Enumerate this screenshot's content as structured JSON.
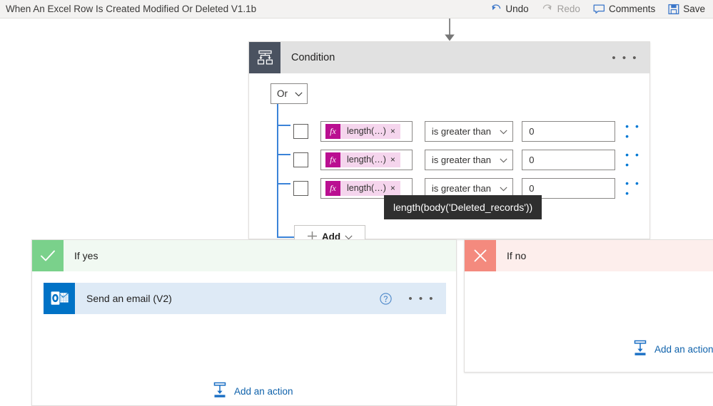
{
  "command_bar": {
    "flow_title": "When An Excel Row Is Created Modified Or Deleted V1.1b",
    "actions": [
      {
        "label": "Undo",
        "icon": "undo-icon",
        "enabled": true
      },
      {
        "label": "Redo",
        "icon": "redo-icon",
        "enabled": false
      },
      {
        "label": "Comments",
        "icon": "comment-icon",
        "enabled": true
      },
      {
        "label": "Save",
        "icon": "save-icon",
        "enabled": true
      }
    ]
  },
  "condition_card": {
    "title": "Condition",
    "icon": "condition-branch-icon",
    "overflow_label": "• • •",
    "logic_operator": {
      "value": "Or",
      "chevron": "chevron-down-icon"
    },
    "rows": [
      {
        "checkbox_checked": false,
        "token": {
          "fx_label": "fx",
          "text": "length(…)",
          "remove": "×"
        },
        "operator": "is greater than",
        "value": "0",
        "overflow_label": "• • •"
      },
      {
        "checkbox_checked": false,
        "token": {
          "fx_label": "fx",
          "text": "length(…)",
          "remove": "×"
        },
        "operator": "is greater than",
        "value": "0",
        "overflow_label": "• • •"
      },
      {
        "checkbox_checked": false,
        "token": {
          "fx_label": "fx",
          "text": "length(…)",
          "remove": "×"
        },
        "operator": "is greater than",
        "value": "0",
        "overflow_label": "• • •"
      }
    ],
    "add_button": {
      "label": "Add",
      "plus": "+",
      "chevron": "chevron-down-icon"
    },
    "expression_tooltip": "length(body('Deleted_records'))"
  },
  "branches": {
    "if_yes": {
      "label": "If yes",
      "icon": "checkmark-icon",
      "header_color": "#f1f9f2",
      "icon_color": "#7ad18b",
      "action": {
        "title": "Send an email (V2)",
        "icon": "outlook-icon",
        "help_icon": "help-circle-icon",
        "overflow_label": "• • •"
      },
      "add_action": {
        "label": "Add an action",
        "icon": "add-action-icon"
      }
    },
    "if_no": {
      "label": "If no",
      "icon": "cross-icon",
      "header_color": "#fdeeec",
      "icon_color": "#f48a7e",
      "add_action": {
        "label": "Add an action",
        "icon": "add-action-icon"
      }
    }
  },
  "colors": {
    "accent_blue": "#0078d4",
    "link_blue": "#0f62ab",
    "tree_line": "#3b83d8",
    "fx_magenta": "#ba0f91",
    "token_pink": "#f5d5ed",
    "condition_icon_bg": "#4a5260",
    "outlook_blue": "#0072c6",
    "tooltip_bg": "#2f2f2f"
  }
}
